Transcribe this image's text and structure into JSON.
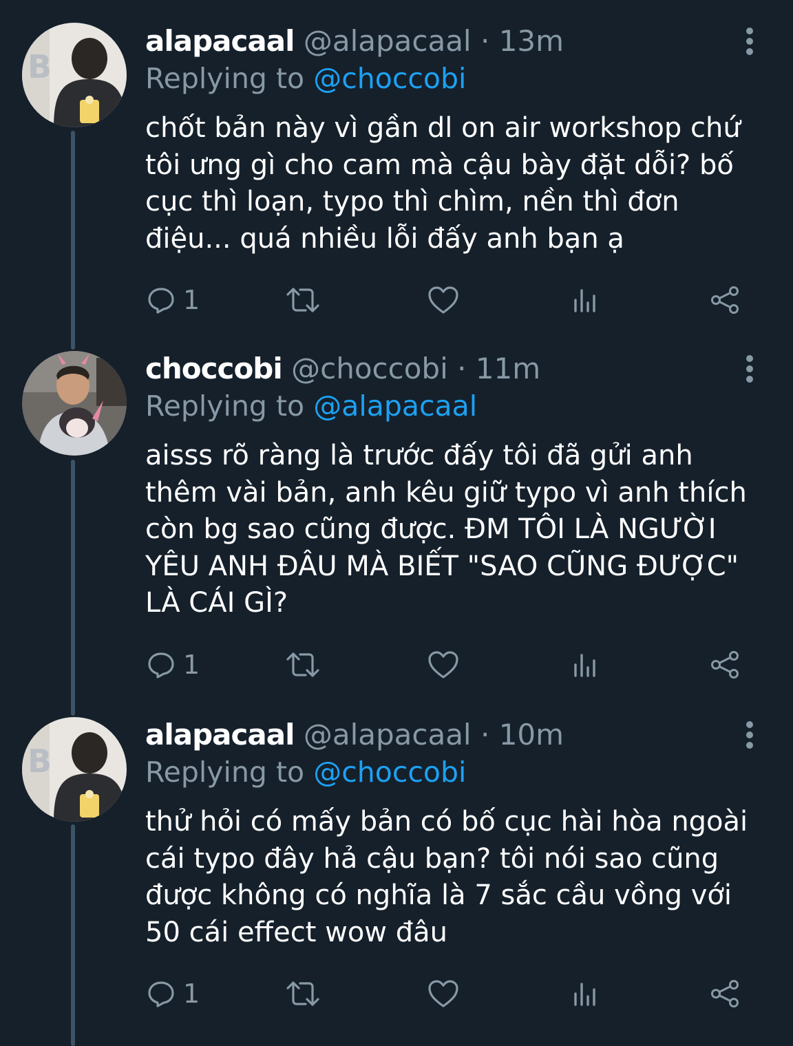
{
  "tweets": [
    {
      "display_name": "alapacaal",
      "handle": "@alapacaal",
      "separator": "·",
      "time": "13m",
      "replying_prefix": "Replying to",
      "replying_to": "@choccobi",
      "text": "chốt bản này vì gần dl on air workshop chứ tôi ưng gì cho cam mà cậu bày đặt dỗi? bố cục thì loạn, typo thì chìm, nền thì đơn điệu... quá nhiều lỗi đấy anh bạn ạ",
      "reply_count": "1"
    },
    {
      "display_name": "choccobi",
      "handle": "@choccobi",
      "separator": "·",
      "time": "11m",
      "replying_prefix": "Replying to",
      "replying_to": "@alapacaal",
      "text": "aisss rõ ràng là trước đấy tôi đã gửi anh thêm vài bản, anh kêu giữ typo vì anh thích còn bg sao cũng được. ĐM TÔI LÀ NGƯỜI YÊU ANH ĐÂU MÀ BIẾT \"SAO CŨNG ĐƯỢC\" LÀ CÁI GÌ?",
      "reply_count": "1"
    },
    {
      "display_name": "alapacaal",
      "handle": "@alapacaal",
      "separator": "·",
      "time": "10m",
      "replying_prefix": "Replying to",
      "replying_to": "@choccobi",
      "text": "thử hỏi có mấy bản có bố cục hài hòa ngoài cái typo đây hả cậu bạn? tôi nói sao cũng được không có nghĩa là 7 sắc cầu vồng với 50 cái effect wow đâu",
      "reply_count": "1"
    }
  ],
  "icons": {
    "reply": "reply-icon",
    "retweet": "retweet-icon",
    "like": "heart-icon",
    "stats": "analytics-icon",
    "share": "share-icon",
    "more": "more-vertical-icon"
  },
  "colors": {
    "background": "#15202b",
    "primary_text": "#ffffff",
    "secondary_text": "#8899a6",
    "link": "#1da1f2",
    "thread_line": "#3d5466"
  }
}
